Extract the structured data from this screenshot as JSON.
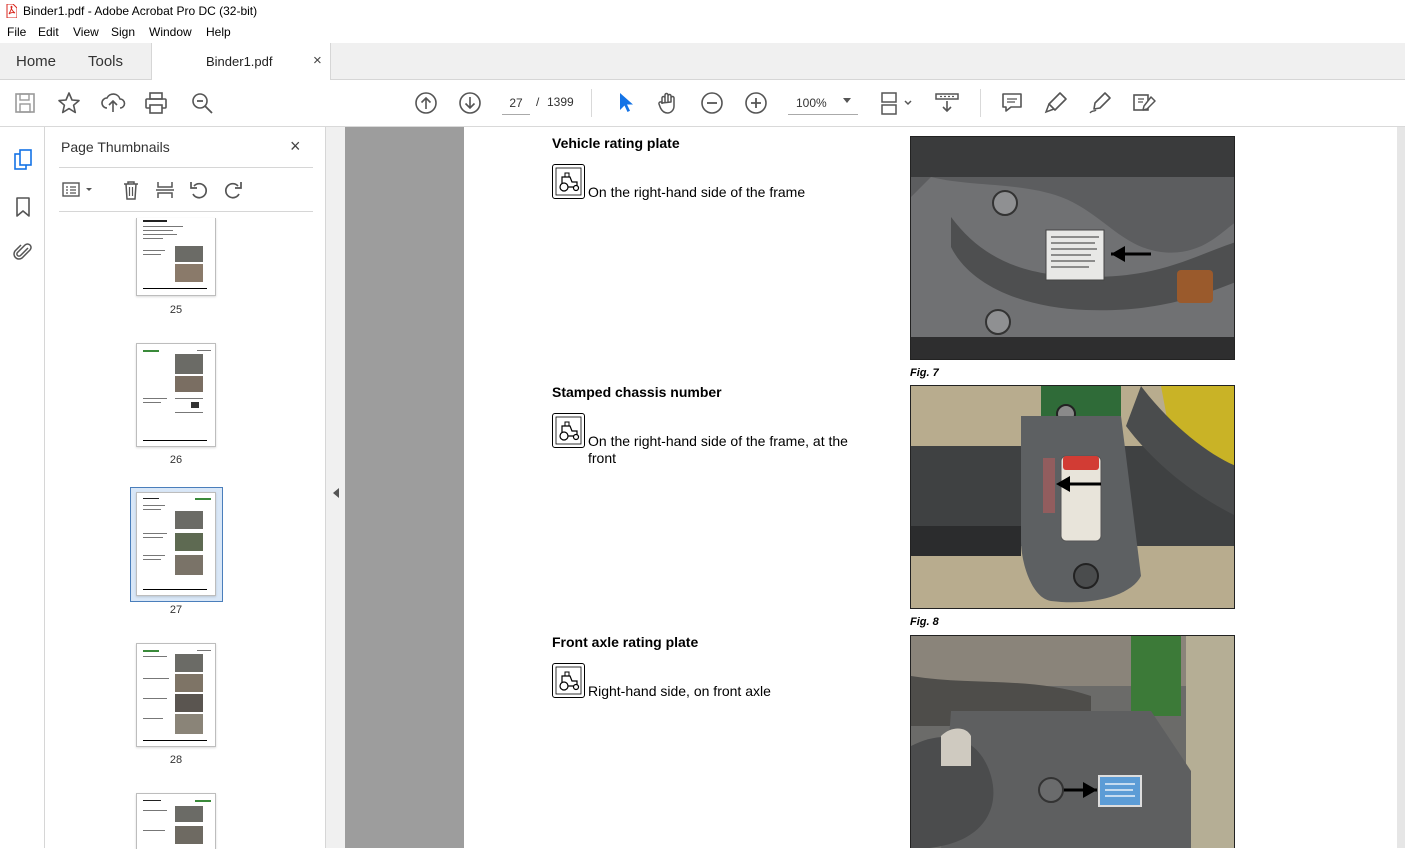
{
  "window": {
    "title": "Binder1.pdf - Adobe Acrobat Pro DC (32-bit)",
    "app_icon": "pdf-icon"
  },
  "menu": [
    "File",
    "Edit",
    "View",
    "Sign",
    "Window",
    "Help"
  ],
  "tabs": {
    "home": "Home",
    "tools": "Tools",
    "document": "Binder1.pdf",
    "close": "×"
  },
  "toolbar": {
    "current_page": "27",
    "separator": "/",
    "total_pages": "1399",
    "zoom": "100%",
    "icons": [
      "save-icon",
      "bookmark-star-icon",
      "upload-icon",
      "print-icon",
      "search-zoom-icon",
      "page-up-icon",
      "page-down-icon",
      "select-cursor-icon",
      "hand-icon",
      "zoom-out-icon",
      "zoom-in-icon",
      "fit-page-icon",
      "scroll-mode-icon",
      "comment-icon",
      "highlight-icon",
      "fill-sign-icon",
      "edit-pdf-icon"
    ]
  },
  "thumbnails_panel": {
    "title": "Page Thumbnails",
    "close": "×",
    "pages": [
      {
        "number": "25"
      },
      {
        "number": "26"
      },
      {
        "number": "27",
        "selected": true
      },
      {
        "number": "28"
      }
    ]
  },
  "document": {
    "sections": [
      {
        "title": "Vehicle rating plate",
        "text": "On the right-hand side of the frame",
        "figure": "Fig. 7"
      },
      {
        "title": "Stamped chassis number",
        "text": "On the right-hand side of the frame, at the front",
        "figure": "Fig. 8"
      },
      {
        "title": "Front axle rating plate",
        "text": "Right-hand side, on front axle",
        "figure": ""
      }
    ]
  },
  "colors": {
    "accent": "#1473e6",
    "selected_thumb": "#4a7ebb",
    "canvas": "#9d9d9d"
  }
}
